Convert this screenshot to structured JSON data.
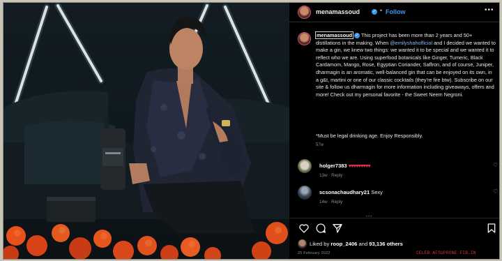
{
  "post": {
    "username": "menamassoud",
    "dot": "•",
    "follow": "Follow",
    "more": "•••",
    "caption_part1": " This project has been more than 2 years and 50+ distillations in the making. When ",
    "caption_mention": "@emilyshahofficial",
    "caption_part2": " and I decided we wanted to make a gin, we knew two things: we wanted it to be special and we wanted it to reflect who we are. Using superfood botanicals like Ginger, Tumeric, Black Cardamom, Mango, Rose, Egyptian Coriander, Saffron, and of course, Juniper, dharmagin is an aromatic, well-balanced gin that can be enjoyed on its own, in a g&t, martini or one of our classic cocktails (they're fire btw). Subscribe on our site & follow us dharmagin for more information including giveaways, offers and more! Check out my personal favorite - the Sweet Neem Negroni.",
    "disclaimer": "*Must be legal drinking age. Enjoy Responsibly.",
    "caption_time": "57w",
    "liked_by_prefix": "Liked by ",
    "liked_by_user": "roop_2406",
    "liked_by_middle": " and ",
    "liked_by_count": "93,136 others",
    "date": "25 February 2022"
  },
  "comments": [
    {
      "user": "holger7383",
      "text": "♥♥♥♥♥♥♥♥♥",
      "meta": "13w  ·  Reply"
    },
    {
      "user": "scsonachaudhary21",
      "text": "Sexy",
      "meta": "14w  ·  Reply"
    }
  ],
  "icons": {
    "verified": "✓",
    "heart_small": "♡"
  },
  "watermark": "CELEB.AFSUPRONE.FIB.IN",
  "colors": {
    "accent": "#3897f0",
    "hearts": "#e8344e",
    "watermark": "#d23c3c"
  }
}
